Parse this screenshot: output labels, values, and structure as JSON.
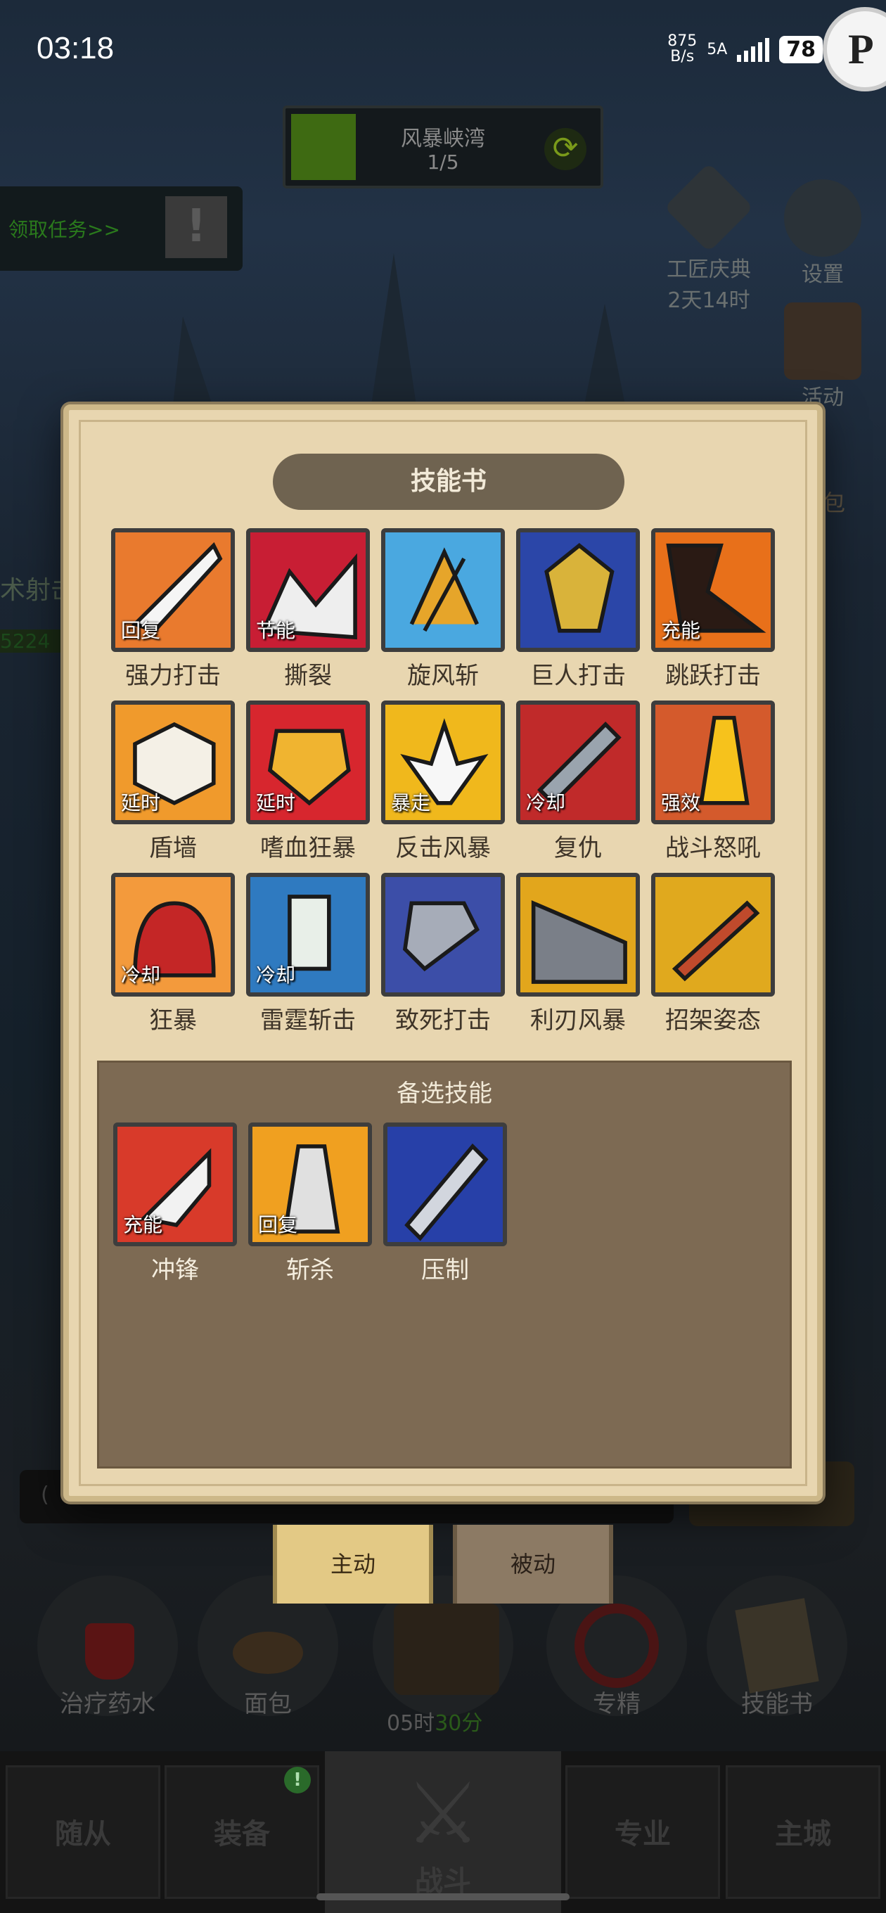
{
  "status_bar": {
    "time": "03:18",
    "net_speed_value": "875",
    "net_speed_unit": "B/s",
    "network": "5A",
    "battery": "78"
  },
  "zone": {
    "name": "风暴峡湾",
    "progress": "1/5"
  },
  "quest": {
    "label": "领取任务>>"
  },
  "side_buttons": {
    "celebration_label": "工匠庆典",
    "celebration_timer": "2天14时",
    "settings_label": "设置",
    "activity_label": "活动"
  },
  "peek": {
    "left_text": "术射击",
    "left_number": "5224",
    "right_text": "包"
  },
  "skill_book": {
    "title": "技能书",
    "skills": [
      {
        "name": "强力打击",
        "tag": "回复",
        "icon": "power-strike-icon"
      },
      {
        "name": "撕裂",
        "tag": "节能",
        "icon": "rend-icon"
      },
      {
        "name": "旋风斩",
        "tag": "",
        "icon": "whirlwind-icon"
      },
      {
        "name": "巨人打击",
        "tag": "",
        "icon": "giant-strike-icon"
      },
      {
        "name": "跳跃打击",
        "tag": "充能",
        "icon": "leap-strike-icon"
      },
      {
        "name": "盾墙",
        "tag": "延时",
        "icon": "shield-wall-icon"
      },
      {
        "name": "嗜血狂暴",
        "tag": "延时",
        "icon": "bloodlust-icon"
      },
      {
        "name": "反击风暴",
        "tag": "暴走",
        "icon": "counter-storm-icon"
      },
      {
        "name": "复仇",
        "tag": "冷却",
        "icon": "revenge-icon"
      },
      {
        "name": "战斗怒吼",
        "tag": "强效",
        "icon": "battle-shout-icon"
      },
      {
        "name": "狂暴",
        "tag": "冷却",
        "icon": "berserk-icon"
      },
      {
        "name": "雷霆斩击",
        "tag": "冷却",
        "icon": "thunder-slash-icon"
      },
      {
        "name": "致死打击",
        "tag": "",
        "icon": "mortal-strike-icon"
      },
      {
        "name": "利刃风暴",
        "tag": "",
        "icon": "bladestorm-icon"
      },
      {
        "name": "招架姿态",
        "tag": "",
        "icon": "parry-stance-icon"
      }
    ],
    "alternate_title": "备选技能",
    "alternates": [
      {
        "name": "冲锋",
        "tag": "充能",
        "icon": "charge-icon"
      },
      {
        "name": "斩杀",
        "tag": "回复",
        "icon": "execute-icon"
      },
      {
        "name": "压制",
        "tag": "",
        "icon": "overpower-icon"
      }
    ]
  },
  "bottom_input": {
    "placeholder": "("
  },
  "tabs": {
    "active": "主动",
    "passive": "被动"
  },
  "quick_items": [
    {
      "label": "治疗药水"
    },
    {
      "label": "面包"
    },
    {
      "label": ""
    },
    {
      "label": "专精"
    },
    {
      "label": "技能书"
    }
  ],
  "timer": {
    "hours": "05时",
    "minutes": "30分"
  },
  "nav": {
    "followers": "随从",
    "equipment": "装备",
    "battle": "战斗",
    "specialty": "专业",
    "main_city": "主城",
    "badge": "!"
  }
}
